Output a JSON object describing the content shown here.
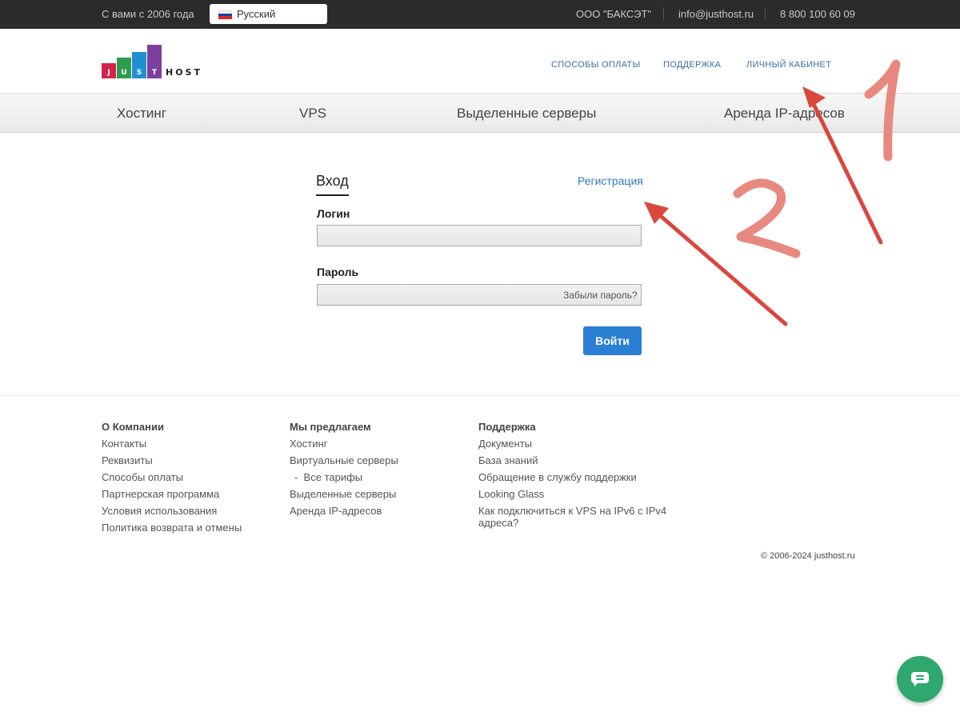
{
  "topbar": {
    "tagline": "С вами с 2006 года",
    "language": "Русский",
    "company": "ООО \"БАКСЭТ\"",
    "email": "info@justhost.ru",
    "phone": "8 800 100 60 09"
  },
  "logo": {
    "letters": [
      "J",
      "U",
      "S",
      "T"
    ],
    "host": "HOST",
    "colors": [
      "#d2234c",
      "#2d9c4b",
      "#1f8fd1",
      "#7b3fa0"
    ]
  },
  "topnav": [
    "СПОСОБЫ ОПЛАТЫ",
    "ПОДДЕРЖКА",
    "ЛИЧНЫЙ КАБИНЕТ"
  ],
  "mainnav": [
    "Хостинг",
    "VPS",
    "Выделенные серверы",
    "Аренда IP-адресов"
  ],
  "login": {
    "tab": "Вход",
    "register": "Регистрация",
    "login_label": "Логин",
    "login_value": "",
    "password_label": "Пароль",
    "password_value": "",
    "forgot": "Забыли пароль?",
    "submit": "Войти"
  },
  "footer": {
    "col1": {
      "title": "О Компании",
      "items": [
        "Контакты",
        "Реквизиты",
        "Способы оплаты",
        "Партнерская программа",
        "Условия использования",
        "Политика возврата и отмены"
      ]
    },
    "col2": {
      "title": "Мы предлагаем",
      "items": [
        "Хостинг",
        "Виртуальные серверы",
        "-  Все тарифы",
        "Выделенные серверы",
        "Аренда IP-адресов"
      ]
    },
    "col3": {
      "title": "Поддержка",
      "items": [
        "Документы",
        "База знаний",
        "Обращение в службу поддержки",
        "Looking Glass",
        "Как подключиться к VPS на IPv6 с IPv4 адреса?"
      ]
    },
    "copyright": "© 2006-2024 justhost.ru"
  },
  "annotations": {
    "marker1": "1",
    "marker2": "2",
    "arrow_color": "#d9473f",
    "marker_color": "#e8897f"
  },
  "chat": {
    "icon": "chat-bubble-icon",
    "color": "#2fa86e"
  }
}
